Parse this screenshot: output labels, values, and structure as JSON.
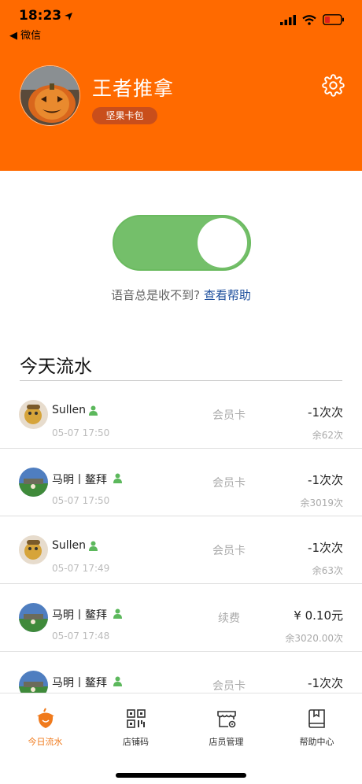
{
  "status": {
    "time": "18:23",
    "back_app": "◀ 微信"
  },
  "profile": {
    "shop_name": "王者推拿",
    "badge": "坚果卡包"
  },
  "voice_help": {
    "text": "语音总是收不到?",
    "link": "查看帮助"
  },
  "section_title": "今天流水",
  "transactions": [
    {
      "name": "Sullen",
      "time": "05-07 17:50",
      "type": "会员卡",
      "amount": "-1次次",
      "remain": "余62次"
    },
    {
      "name": "马明丨鳌拜",
      "time": "05-07 17:50",
      "type": "会员卡",
      "amount": "-1次次",
      "remain": "余3019次"
    },
    {
      "name": "Sullen",
      "time": "05-07 17:49",
      "type": "会员卡",
      "amount": "-1次次",
      "remain": "余63次"
    },
    {
      "name": "马明丨鳌拜",
      "time": "05-07 17:48",
      "type": "续费",
      "amount": "¥ 0.10元",
      "remain": "余3020.00次"
    },
    {
      "name": "马明丨鳌拜",
      "time": "",
      "type": "会员卡",
      "amount": "-1次次",
      "remain": ""
    }
  ],
  "tabs": [
    {
      "label": "今日流水",
      "icon": "acorn-icon"
    },
    {
      "label": "店铺码",
      "icon": "qrcode-icon"
    },
    {
      "label": "店员管理",
      "icon": "store-gear-icon"
    },
    {
      "label": "帮助中心",
      "icon": "book-icon"
    }
  ],
  "colors": {
    "header": "#ff6a00",
    "toggle_on": "#74bf6a",
    "link": "#1c4e9c",
    "active_tab": "#f07a1c"
  }
}
